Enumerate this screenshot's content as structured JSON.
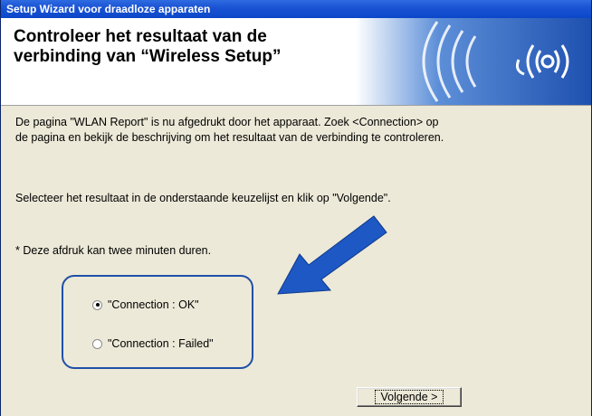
{
  "window": {
    "title": "Setup Wizard voor draadloze apparaten"
  },
  "header": {
    "title_line1": "Controleer het resultaat van de",
    "title_line2": "verbinding van “Wireless Setup”",
    "graphic_icon": "wireless-signal-icon"
  },
  "content": {
    "paragraph1_line1": "De pagina \"WLAN Report\" is nu afgedrukt door het apparaat. Zoek <Connection> op",
    "paragraph1_line2": "de pagina en bekijk de beschrijving om het resultaat van de verbinding te controleren.",
    "paragraph2": "Selecteer het resultaat in de onderstaande keuzelijst en klik op \"Volgende\".",
    "note": "* Deze afdruk kan twee minuten duren.",
    "options": [
      {
        "label": "\"Connection : OK\"",
        "selected": true
      },
      {
        "label": "\"Connection : Failed\"",
        "selected": false
      }
    ]
  },
  "buttons": {
    "next_label": "Volgende >"
  },
  "colors": {
    "titlebar": "#0b47c9",
    "accent_blue": "#1f4fa8",
    "arrow_blue": "#1d58c4",
    "dialog_bg": "#ece9d8"
  }
}
